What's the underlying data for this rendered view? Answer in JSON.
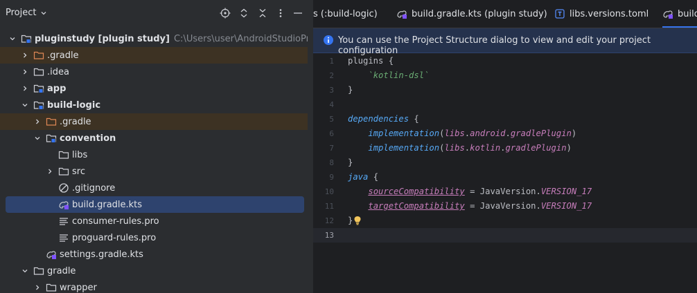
{
  "panel": {
    "title": "Project",
    "header_icons": [
      "locate-icon",
      "expand-collapse-icon",
      "collapse-all-icon",
      "more-icon",
      "minimize-icon"
    ]
  },
  "tree": [
    {
      "label": "pluginstudy [plugin study]",
      "path": "C:\\Users\\user\\AndroidStudioProjects\\pluginst",
      "icon": "module-folder-icon",
      "expanded": true,
      "bold": true
    },
    {
      "label": ".gradle",
      "icon": "excluded-folder-icon",
      "expanded": false,
      "excluded": true
    },
    {
      "label": ".idea",
      "icon": "folder-icon",
      "expanded": false
    },
    {
      "label": "app",
      "icon": "module-folder-icon",
      "expanded": false,
      "bold": true
    },
    {
      "label": "build-logic",
      "icon": "module-folder-icon",
      "expanded": true,
      "bold": true
    },
    {
      "label": ".gradle",
      "icon": "excluded-folder-icon",
      "expanded": false,
      "excluded": true
    },
    {
      "label": "convention",
      "icon": "module-folder-icon",
      "expanded": true,
      "bold": true
    },
    {
      "label": "libs",
      "icon": "folder-icon"
    },
    {
      "label": "src",
      "icon": "folder-icon",
      "expanded": false
    },
    {
      "label": ".gitignore",
      "icon": "gitignore-icon"
    },
    {
      "label": "build.gradle.kts",
      "icon": "gradle-kts-icon",
      "selected": true
    },
    {
      "label": "consumer-rules.pro",
      "icon": "text-file-icon"
    },
    {
      "label": "proguard-rules.pro",
      "icon": "text-file-icon"
    },
    {
      "label": "settings.gradle.kts",
      "icon": "gradle-kts-icon"
    },
    {
      "label": "gradle",
      "icon": "folder-icon",
      "expanded": true
    },
    {
      "label": "wrapper",
      "icon": "folder-icon",
      "expanded": false
    }
  ],
  "tabs": [
    {
      "label": "s (:build-logic)",
      "icon": ""
    },
    {
      "label": "build.gradle.kts (plugin study)",
      "icon": "gradle-kts-icon"
    },
    {
      "label": "libs.versions.toml",
      "icon": "toml-icon"
    },
    {
      "label": "build",
      "icon": "gradle-kts-icon",
      "active": true
    }
  ],
  "notice": {
    "text": "You can use the Project Structure dialog to view and edit your project configuration"
  },
  "code": {
    "line_numbers": [
      "1",
      "2",
      "3",
      "4",
      "5",
      "6",
      "7",
      "8",
      "9",
      "10",
      "11",
      "12",
      "13"
    ],
    "current_line": 13,
    "l1_a": "plugins {",
    "l2_a": "`kotlin-dsl`",
    "l3_a": "}",
    "l5_a": "dependencies",
    "l5_b": " {",
    "l6_a": "implementation",
    "l6_b": "(",
    "l6_c": "libs",
    "l6_d": ".",
    "l6_e": "android",
    "l6_f": ".",
    "l6_g": "gradlePlugin",
    "l6_h": ")",
    "l7_a": "implementation",
    "l7_b": "(",
    "l7_c": "libs",
    "l7_d": ".",
    "l7_e": "kotlin",
    "l7_f": ".",
    "l7_g": "gradlePlugin",
    "l7_h": ")",
    "l8_a": "}",
    "l9_a": "java",
    "l9_b": " {",
    "l10_a": "sourceCompatibility",
    "l10_b": " = JavaVersion.",
    "l10_c": "VERSION_17",
    "l11_a": "targetCompatibility",
    "l11_b": " = JavaVersion.",
    "l11_c": "VERSION_17",
    "l12_a": "}"
  },
  "colors": {
    "accent": "#3574f0",
    "selection": "#2e436e",
    "excluded_bg": "#3d3223",
    "notice_bg": "#25324d"
  }
}
